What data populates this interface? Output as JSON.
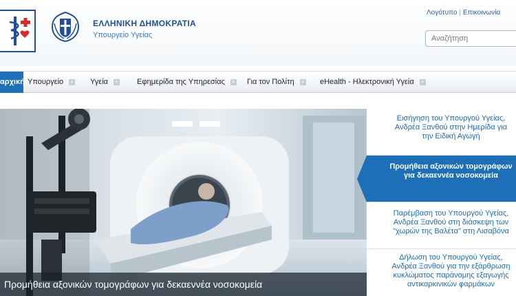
{
  "header": {
    "title": "ΕΛΛΗΝΙΚΗ ΔΗΜΟΚΡΑΤΙΑ",
    "subtitle": "Υπουργείο Υγείας",
    "links": [
      "Λογότυπο",
      "Επικοινωνία"
    ],
    "search_placeholder": "Αναζήτηση"
  },
  "nav": {
    "items": [
      "αρχική",
      "Υπουργείο",
      "Υγεία",
      "Εφημερίδα της Υπηρεσίας",
      "Για τον Πολίτη",
      "eHealth - Ηλεκτρονική Υγεία"
    ]
  },
  "hero": {
    "caption": "Προμήθεια αξονικών τομογράφων για δεκαεννέα νοσοκομεία"
  },
  "news": [
    {
      "title": "Εισήγηση του Υπουργού Υγείας,\nΑνδρέα Ξανθού στην Ημερίδα για\nτην Ειδική Αγωγή",
      "active": false
    },
    {
      "title": "Προμήθεια αξονικών τομογράφων\nγια δεκαεννέα νοσοκομεία",
      "active": true
    },
    {
      "title": "Παρέμβαση του Υπουργού Υγείας,\nΑνδρέα Ξανθού στη διάσκεψη των\n\"χωρών της Βαλέτα\" στη Λισαβόνα",
      "active": false
    },
    {
      "title": "Δήλωση του Υπουργού Υγείας,\nΑνδρέα Ξανθού για την εξάρθρωση\nκυκλώματος παράνομης εξαγωγής\nαντικαρκινικών φαρμάκων",
      "active": false
    }
  ],
  "colors": {
    "brand": "#1d6fb8",
    "link": "#1a6bb5"
  }
}
